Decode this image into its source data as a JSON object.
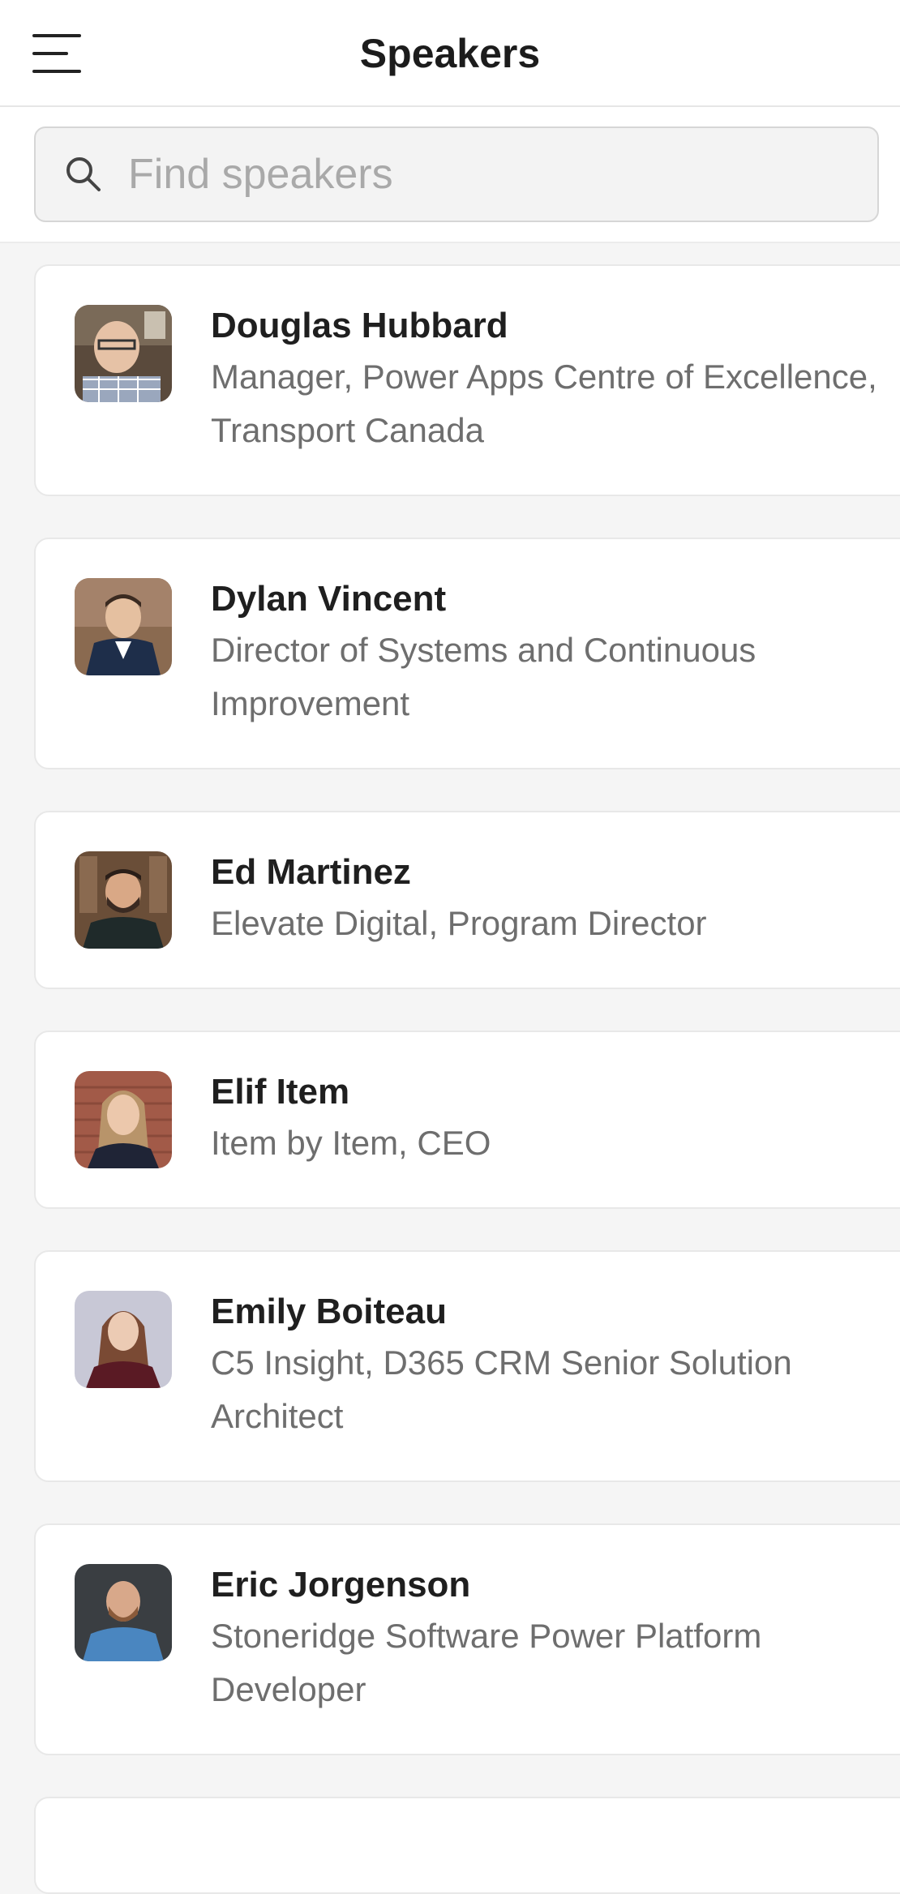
{
  "header": {
    "title": "Speakers",
    "menu_icon": "hamburger-menu-icon"
  },
  "search": {
    "placeholder": "Find speakers",
    "value": "",
    "icon": "search-icon"
  },
  "speakers": [
    {
      "name": "Douglas Hubbard",
      "line1": "Manager, Power Apps Centre of Excellence,",
      "line2": "Transport Canada"
    },
    {
      "name": "Dylan Vincent",
      "line1": "Director of Systems and Continuous Improvement",
      "line2": ""
    },
    {
      "name": "Ed Martinez",
      "line1": "Elevate Digital, Program Director",
      "line2": ""
    },
    {
      "name": "Elif Item",
      "line1": "Item by Item, CEO",
      "line2": ""
    },
    {
      "name": "Emily Boiteau",
      "line1": "C5 Insight, D365 CRM Senior Solution Architect",
      "line2": ""
    },
    {
      "name": "Eric Jorgenson",
      "line1": "Stoneridge Software Power Platform Developer",
      "line2": ""
    }
  ],
  "colors": {
    "background": "#f5f5f5",
    "card": "#ffffff",
    "name_text": "#1f1f1f",
    "secondary_text": "#6e6e6e",
    "placeholder_text": "#a9a9a9"
  }
}
